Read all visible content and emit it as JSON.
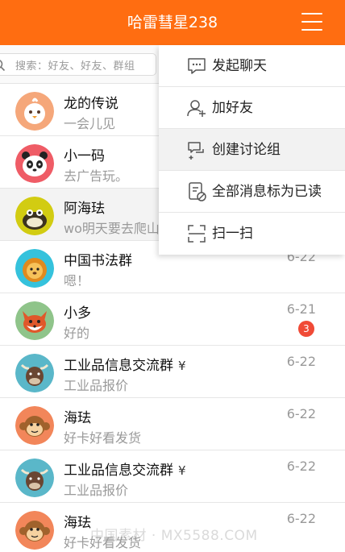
{
  "header": {
    "title": "哈雷彗星238"
  },
  "search": {
    "placeholder": "搜索：好友、好友、群组"
  },
  "chats": [
    {
      "name": "龙的传说",
      "message": "一会儿见",
      "time": "",
      "badge": "",
      "avatar": "chick-avatar-icon",
      "color": "#f5a77a"
    },
    {
      "name": "小一码",
      "message": "去广告玩。",
      "time": "",
      "badge": "",
      "avatar": "panda-avatar-icon",
      "color": "#ef5c66"
    },
    {
      "name": "阿海珐",
      "message": "wo明天要去爬山",
      "time": "",
      "badge": "",
      "avatar": "monster-avatar-icon",
      "color": "#d2cc12"
    },
    {
      "name": "中国书法群",
      "message": "嗯！",
      "time": "6-22",
      "badge": "",
      "avatar": "lion-avatar-icon",
      "color": "#35c2dc"
    },
    {
      "name": "小多",
      "message": "好的",
      "time": "6-21",
      "badge": "3",
      "avatar": "fox-avatar-icon",
      "color": "#8fc48a"
    },
    {
      "name": "工业品信息交流群",
      "yen": "¥",
      "message": "工业品报价",
      "time": "6-22",
      "badge": "",
      "avatar": "yak-avatar-icon",
      "color": "#5ab7c9"
    },
    {
      "name": "海珐",
      "message": "好卡好看发货",
      "time": "6-22",
      "badge": "",
      "avatar": "monkey-avatar-icon",
      "color": "#f2865a"
    },
    {
      "name": "工业品信息交流群",
      "yen": "¥",
      "message": "工业品报价",
      "time": "6-22",
      "badge": "",
      "avatar": "yak-avatar-icon",
      "color": "#5ab7c9"
    },
    {
      "name": "海珐",
      "message": "好卡好看发货",
      "time": "6-22",
      "badge": "",
      "avatar": "monkey-avatar-icon",
      "color": "#f2865a"
    }
  ],
  "menu": [
    {
      "label": "发起聊天",
      "icon": "chat-bubble-icon"
    },
    {
      "label": "加好友",
      "icon": "add-friend-icon"
    },
    {
      "label": "创建讨论组",
      "icon": "discussion-group-icon"
    },
    {
      "label": "全部消息标为已读",
      "icon": "mark-read-icon"
    },
    {
      "label": "扫一扫",
      "icon": "scan-icon"
    }
  ],
  "watermark": "中国素材 · MX5588.COM",
  "colors": {
    "accent": "#ff6d11",
    "badge": "#f04a36"
  }
}
